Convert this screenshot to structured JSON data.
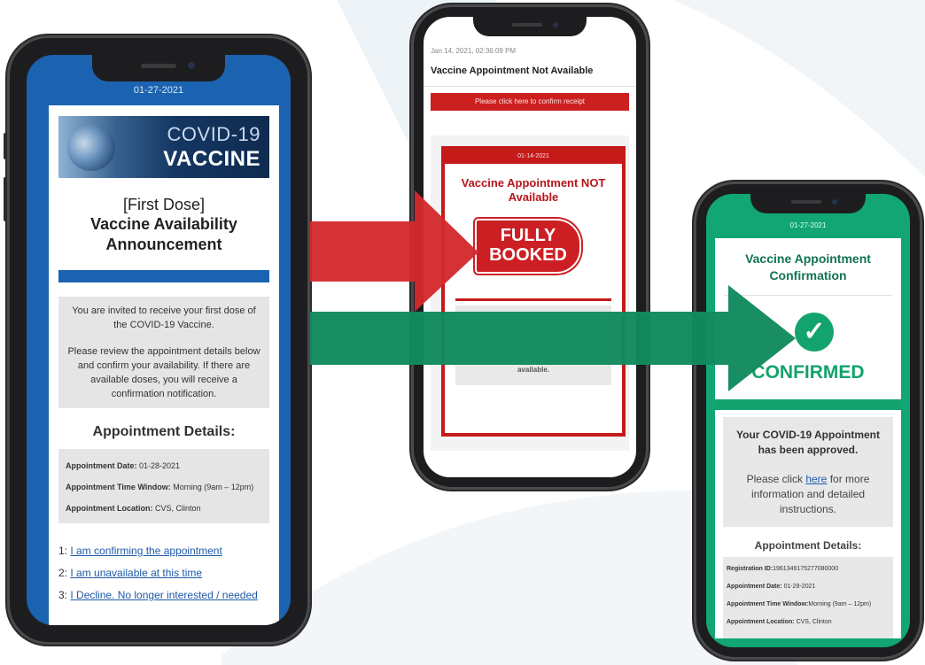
{
  "colors": {
    "blue": "#1b63b0",
    "red": "#cc1f1f",
    "green": "#13a36d",
    "arrow_red": "#d32a2e",
    "arrow_green": "#128a5e"
  },
  "phone1": {
    "date": "01-27-2021",
    "banner_line1": "COVID-19",
    "banner_line2": "VACCINE",
    "subtitle": "[First Dose]",
    "title": "Vaccine Availability Announcement",
    "invite_text": "You are invited to receive your first dose of the COVID-19 Vaccine.",
    "review_text": "Please review the appointment details below and confirm your availability. If there are available doses, you will receive a confirmation notification.",
    "details_heading": "Appointment Details:",
    "details": [
      {
        "label": "Appointment Date:",
        "value": "01-28-2021"
      },
      {
        "label": "Appointment Time Window:",
        "value": "Morning (9am – 12pm)"
      },
      {
        "label": "Appointment Location:",
        "value": "CVS, Clinton"
      }
    ],
    "options": [
      {
        "num": "1:",
        "text": "I am confirming the appointment"
      },
      {
        "num": "2:",
        "text": "I am unavailable at this time"
      },
      {
        "num": "3:",
        "text": "I Decline. No longer interested / needed"
      }
    ]
  },
  "phone2": {
    "timestamp": "Jan 14, 2021, 02:36:09 PM",
    "header": "Vaccine Appointment Not Available",
    "confirm_button": "Please click here to confirm receipt",
    "card_date": "01-14-2021",
    "card_title": "Vaccine Appointment NOT Available",
    "stamp_line1": "FULLY",
    "stamp_line2": "BOOKED",
    "available_text": "available."
  },
  "phone3": {
    "date": "01-27-2021",
    "title": "Vaccine Appointment Confirmation",
    "status": "CONFIRMED",
    "approved_text": "Your COVID-19 Appointment has been approved.",
    "info_prefix": "Please click ",
    "info_link": "here",
    "info_suffix": " for more information and detailed instructions.",
    "details_heading": "Appointment Details:",
    "details": [
      {
        "label": "Registration ID:",
        "value": "1961349175277080000"
      },
      {
        "label": "Appointment Date:",
        "value": "01-28-2021"
      },
      {
        "label": "Appointment Time Window:",
        "value": "Morning (9am – 12pm)"
      },
      {
        "label": "Appointment Location:",
        "value": "CVS, Clinton"
      }
    ]
  }
}
